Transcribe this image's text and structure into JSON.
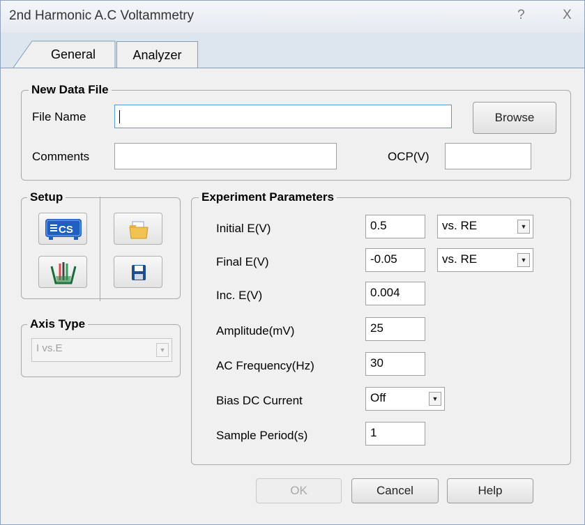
{
  "window": {
    "title": "2nd Harmonic A.C Voltammetry",
    "help_glyph": "?",
    "close_glyph": "X"
  },
  "tabs": [
    {
      "label": "General",
      "active": true
    },
    {
      "label": "Analyzer",
      "active": false
    }
  ],
  "new_data_file": {
    "legend": "New Data File",
    "file_name_label": "File Name",
    "file_name_value": "",
    "browse_label": "Browse",
    "comments_label": "Comments",
    "comments_value": "",
    "ocp_label": "OCP(V)",
    "ocp_value": ""
  },
  "setup": {
    "legend": "Setup",
    "icons": [
      "cs-instrument-icon",
      "open-folder-icon",
      "electrode-cell-icon",
      "save-disk-icon"
    ]
  },
  "axis_type": {
    "legend": "Axis Type",
    "selected": "I vs.E",
    "disabled": true
  },
  "experiment": {
    "legend": "Experiment Parameters",
    "initial_e": {
      "label": "Initial E(V)",
      "value": "0.5",
      "ref": "vs. RE"
    },
    "final_e": {
      "label": "Final E(V)",
      "value": "-0.05",
      "ref": "vs. RE"
    },
    "inc_e": {
      "label": "Inc. E(V)",
      "value": "0.004"
    },
    "amplitude": {
      "label": "Amplitude(mV)",
      "value": "25"
    },
    "ac_frequency": {
      "label": "AC Frequency(Hz)",
      "value": "30"
    },
    "bias_dc": {
      "label": "Bias DC Current",
      "value": "Off"
    },
    "sample_period": {
      "label": "Sample Period(s)",
      "value": "1"
    }
  },
  "buttons": {
    "ok": "OK",
    "cancel": "Cancel",
    "help": "Help"
  },
  "colors": {
    "accent_blue": "#1f5fbf",
    "focus_border": "#5b9bd5",
    "tab_strip": "#dde5ee"
  }
}
